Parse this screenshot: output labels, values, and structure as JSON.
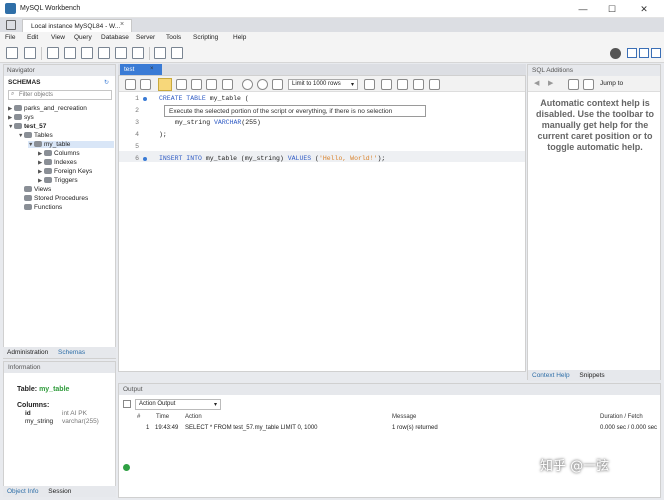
{
  "window": {
    "title": "MySQL Workbench",
    "minimize": "—",
    "maximize": "☐",
    "close": "✕"
  },
  "connection_tab": {
    "label": "Local instance MySQL84 - W...",
    "close": "×"
  },
  "menu": [
    "File",
    "Edit",
    "View",
    "Query",
    "Database",
    "Server",
    "Tools",
    "Scripting",
    "Help"
  ],
  "navigator": {
    "header": "Navigator",
    "schemas_label": "SCHEMAS",
    "filter_placeholder": "Filter objects",
    "tree": {
      "schema1": "parks_and_recreation",
      "schema2": "sys",
      "schema3": "test_57",
      "tables": "Tables",
      "table": "my_table",
      "columns": "Columns",
      "indexes": "Indexes",
      "foreign_keys": "Foreign Keys",
      "triggers": "Triggers",
      "views": "Views",
      "procedures": "Stored Procedures",
      "functions": "Functions"
    },
    "tabs": [
      "Administration",
      "Schemas"
    ]
  },
  "information": {
    "header": "Information",
    "table_label": "Table:",
    "table_name": "my_table",
    "columns_label": "Columns:",
    "col1_name": "id",
    "col1_type": "int AI PK",
    "col2_name": "my_string",
    "col2_type": "varchar(255)",
    "tabs": [
      "Object Info",
      "Session"
    ]
  },
  "editor": {
    "tab_label": "test",
    "tab_close": "×",
    "limit_label": "Limit to 1000 rows",
    "tooltip": "Execute the selected portion of the script or everything, if there is no selection",
    "line_numbers": [
      "1",
      "2",
      "3",
      "4",
      "5",
      "6"
    ],
    "line1_kw": "CREATE TABLE",
    "line1_rest": " my_table (",
    "line3_text": "my_string ",
    "line3_kw": "VARCHAR",
    "line3_rest": "(255)",
    "line4": ");",
    "line6_kw1": "INSERT INTO",
    "line6_mid1": " my_table (my_string) ",
    "line6_kw2": "VALUES",
    "line6_mid2": " (",
    "line6_str": "'Hello, World!'",
    "line6_end": ");"
  },
  "sql_additions": {
    "header": "SQL Additions",
    "jump_to": "Jump to",
    "help_text": "Automatic context help is disabled. Use the toolbar to manually get help for the current caret position or to toggle automatic help.",
    "tabs": [
      "Context Help",
      "Snippets"
    ]
  },
  "output": {
    "header": "Output",
    "select_value": "Action Output",
    "columns": [
      "#",
      "Time",
      "Action",
      "Message",
      "Duration / Fetch"
    ],
    "row": {
      "num": "1",
      "time": "19:43:49",
      "action": "SELECT * FROM test_57.my_table LIMIT 0, 1000",
      "message": "1 row(s) returned",
      "duration": "0.000 sec / 0.000 sec"
    }
  },
  "watermark": "知乎 @一弦"
}
